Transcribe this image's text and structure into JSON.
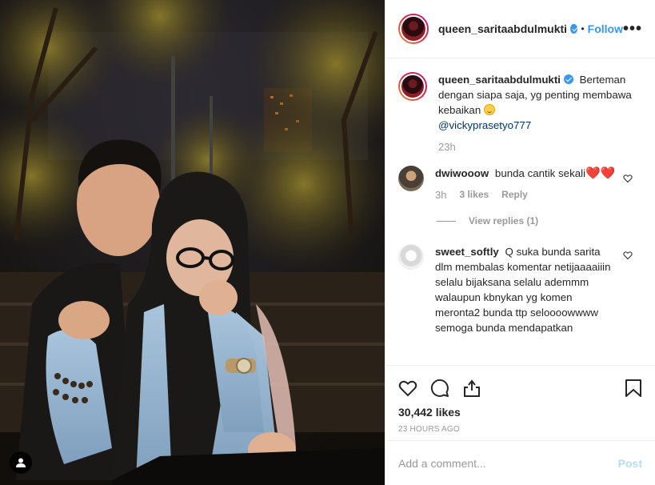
{
  "post": {
    "username": "queen_saritaabdulmukti",
    "verified": true,
    "separator": "•",
    "follow_label": "Follow",
    "more_label": "•••",
    "caption": {
      "username": "queen_saritaabdulmukti",
      "text": "Berteman dengan siapa saja, yg penting membawa kebaikan",
      "mention": "@vickyprasetyo777",
      "time": "23h"
    },
    "comments": [
      {
        "username": "dwiwooow",
        "text": "bunda cantik sekali",
        "emoji": "❤️❤️",
        "time": "3h",
        "likes": "3 likes",
        "reply_label": "Reply",
        "view_replies": "View replies (1)"
      },
      {
        "username": "sweet_softly",
        "text": "Q suka bunda sarita dlm membalas komentar netijaaaaiiin selalu bijaksana selalu ademmm walaupun kbnykan yg komen meronta2 bunda ttp seloooowwww semoga bunda mendapatkan"
      }
    ],
    "likes": "30,442 likes",
    "time_ago": "23 HOURS AGO",
    "comment_placeholder": "Add a comment...",
    "post_label": "Post"
  },
  "colors": {
    "accent": "#3897f0",
    "muted": "#999999",
    "post_disabled": "#b2dffc"
  },
  "icons": [
    "user-tag-icon",
    "heart-icon",
    "comment-icon",
    "share-icon",
    "bookmark-icon",
    "more-icon",
    "verified-icon"
  ]
}
